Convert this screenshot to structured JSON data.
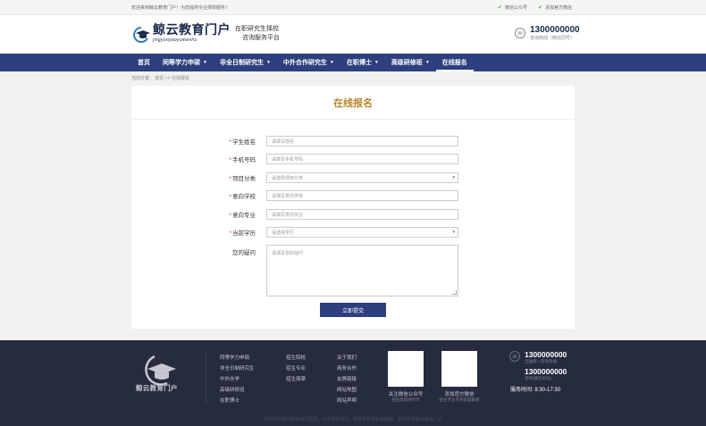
{
  "topbar": {
    "welcome": "欢迎来到鲸云教育门户！为您提供专业择校服务！",
    "links": [
      "微信公众号",
      "添加官方微信"
    ]
  },
  "header": {
    "logo_cn": "鲸云教育门户",
    "logo_py": "jingyunjiaoyumenhu",
    "slogan_line1": "在职研究生择校",
    "slogan_line2": "咨询服务平台",
    "phone": "1300000000",
    "phone_sub": "咨询热线（微信同号）"
  },
  "nav": {
    "items": [
      {
        "label": "首页",
        "has_caret": false,
        "active": false
      },
      {
        "label": "同等学力申硕",
        "has_caret": true,
        "active": false
      },
      {
        "label": "非全日制研究生",
        "has_caret": true,
        "active": false
      },
      {
        "label": "中外合作研究生",
        "has_caret": true,
        "active": false
      },
      {
        "label": "在职博士",
        "has_caret": true,
        "active": false
      },
      {
        "label": "高级研修班",
        "has_caret": true,
        "active": false
      },
      {
        "label": "在线报名",
        "has_caret": false,
        "active": true
      }
    ]
  },
  "breadcrumb": {
    "text": "当前位置： 首页 >> 在线报名"
  },
  "form": {
    "title": "在线报名",
    "fields": [
      {
        "label": "学生姓名",
        "required": true,
        "placeholder": "请填写姓名",
        "type": "input"
      },
      {
        "label": "手机号码",
        "required": true,
        "placeholder": "请填写手机号码",
        "type": "input"
      },
      {
        "label": "项目分类",
        "required": true,
        "placeholder": "请选择项目分类",
        "type": "select"
      },
      {
        "label": "意向学校",
        "required": true,
        "placeholder": "请填写意向学校",
        "type": "input"
      },
      {
        "label": "意向专业",
        "required": true,
        "placeholder": "请填写意向专业",
        "type": "input"
      },
      {
        "label": "当前学历",
        "required": true,
        "placeholder": "请选择学历",
        "type": "select"
      }
    ],
    "question_label": "您的疑问",
    "question_placeholder": "请填写您的疑问",
    "submit_label": "立即提交"
  },
  "footer": {
    "logo_text": "鲸云教育门户",
    "col1": [
      "同等学力申硕",
      "非全日制研究生",
      "中外办学",
      "高级研修班",
      "在职博士"
    ],
    "col2": [
      "招生院校",
      "招生专业",
      "招生简章"
    ],
    "col3": [
      "关于我们",
      "商务合作",
      "友情链接",
      "网站地图",
      "网站声明"
    ],
    "qr1_caption": "关注微信公众号",
    "qr1_sub": "招生政策随时享",
    "qr2_caption": "添加官方微信",
    "qr2_sub": "招生专业老师答疑解惑",
    "phone1": "1300000000",
    "phone1_sub": "全国统一咨询热线",
    "phone2": "1300000000",
    "phone2_sub": "老师(微信同号)",
    "hours_label": "服务时间:",
    "hours_value": "8:30-17:30",
    "copyright": "本网站所有内容来源互联网，仅供参考交流，如有侵权请联系删除，版权所有鲸云教育门户"
  }
}
